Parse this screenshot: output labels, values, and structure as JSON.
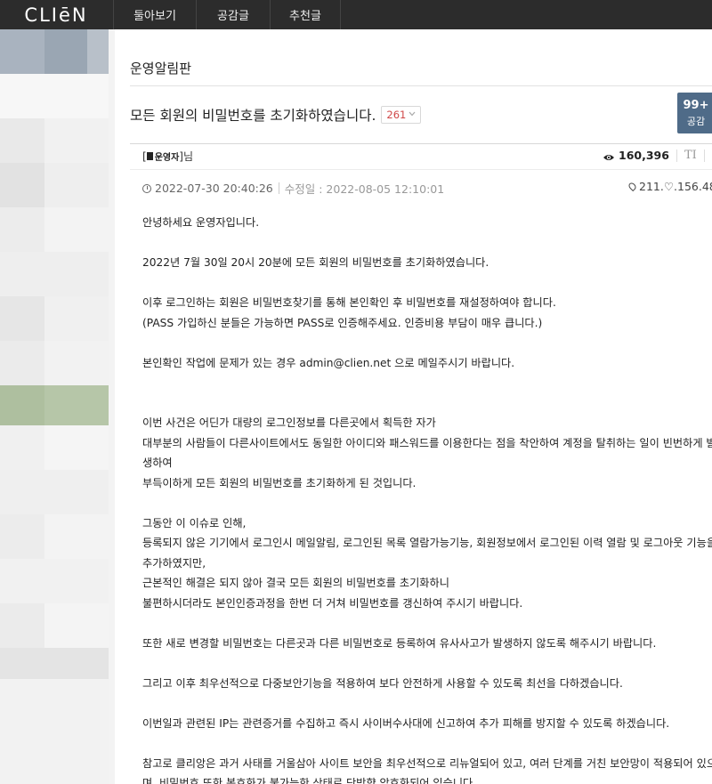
{
  "header": {
    "logo_text": "CLIēN",
    "nav": [
      "둘아보기",
      "공감글",
      "추천글"
    ]
  },
  "board": {
    "title": "운영알림판"
  },
  "post": {
    "title": "모든 회원의 비밀번호를 초기화하였습니다.",
    "comment_count": "261",
    "like_count": "99+",
    "like_label": "공감",
    "author_tag": "운영자",
    "author_suffix": "님",
    "views": "160,396",
    "font_icon_label": "TI",
    "date": "2022-07-30 20:40:26",
    "modified": "수정일 : 2022-08-05 12:10:01",
    "ip": "211.♡.156.48",
    "body": [
      "안녕하세요 운영자입니다.",
      "",
      "2022년 7월 30일 20시 20분에 모든 회원의 비밀번호를 초기화하였습니다.",
      "",
      "이후 로그인하는 회원은 비밀번호찾기를 통해 본인확인 후 비밀번호를 재설정하여야 합니다.",
      "(PASS 가입하신 분들은 가능하면 PASS로 인증해주세요. 인증비용 부담이 매우 큽니다.)",
      "",
      "본인확인 작업에 문제가 있는 경우 admin@clien.net 으로 메일주시기 바랍니다.",
      "",
      "",
      "이번 사건은 어딘가 대량의 로그인정보를 다른곳에서 획득한 자가",
      "대부분의 사람들이 다른사이트에서도 동일한 아이디와 패스워드를 이용한다는 점을 착안하여 계정을 탈취하는 일이 빈번하게 발",
      "생하여",
      "부득이하게 모든 회원의 비밀번호를 초기화하게 된 것입니다.",
      "",
      "그동안 이 이슈로 인해,",
      "등록되지 않은 기기에서 로그인시 메일알림, 로그인된 목록 열람가능기능, 회원정보에서 로그인된 이력 열람 및 로그아웃 기능을",
      "추가하였지만,",
      "근본적인 해결은 되지 않아 결국 모든 회원의 비밀번호를 초기화하니",
      "불편하시더라도 본인인증과정을 한번 더 거쳐 비밀번호를 갱신하여 주시기 바랍니다.",
      "",
      "또한 새로 변경할 비밀번호는 다른곳과 다른 비밀번호로 등록하여 유사사고가 발생하지 않도록 해주시기 바랍니다.",
      "",
      "그리고 이후 최우선적으로 다중보안기능을 적용하여 보다 안전하게 사용할 수 있도록 최선을 다하겠습니다.",
      "",
      "이번일과 관련된 IP는 관련증거를 수집하고 즉시 사이버수사대에 신고하여 추가 피해를 방지할 수 있도록 하겠습니다.",
      "",
      "참고로 클리앙은 과거 사태를 거울삼아 사이트 보안을 최우선적으로 리뉴얼되어 있고, 여러 단계를 거친 보안망이 적용되어 있으",
      "며, 비밀번호 또한 복호화가 불가능한 상태로 단방향 암호화되어 있습니다."
    ]
  },
  "icons": {
    "views": "eye-icon",
    "font_size": "font-size-icon",
    "contrast": "contrast-icon",
    "date": "clock-icon",
    "ip": "location-pin-icon",
    "comment_toggle": "chevron-down-icon"
  },
  "colors": {
    "topbar": "#2c2c2c",
    "like_box": "#4f6b88",
    "comment_count": "#d04848"
  }
}
